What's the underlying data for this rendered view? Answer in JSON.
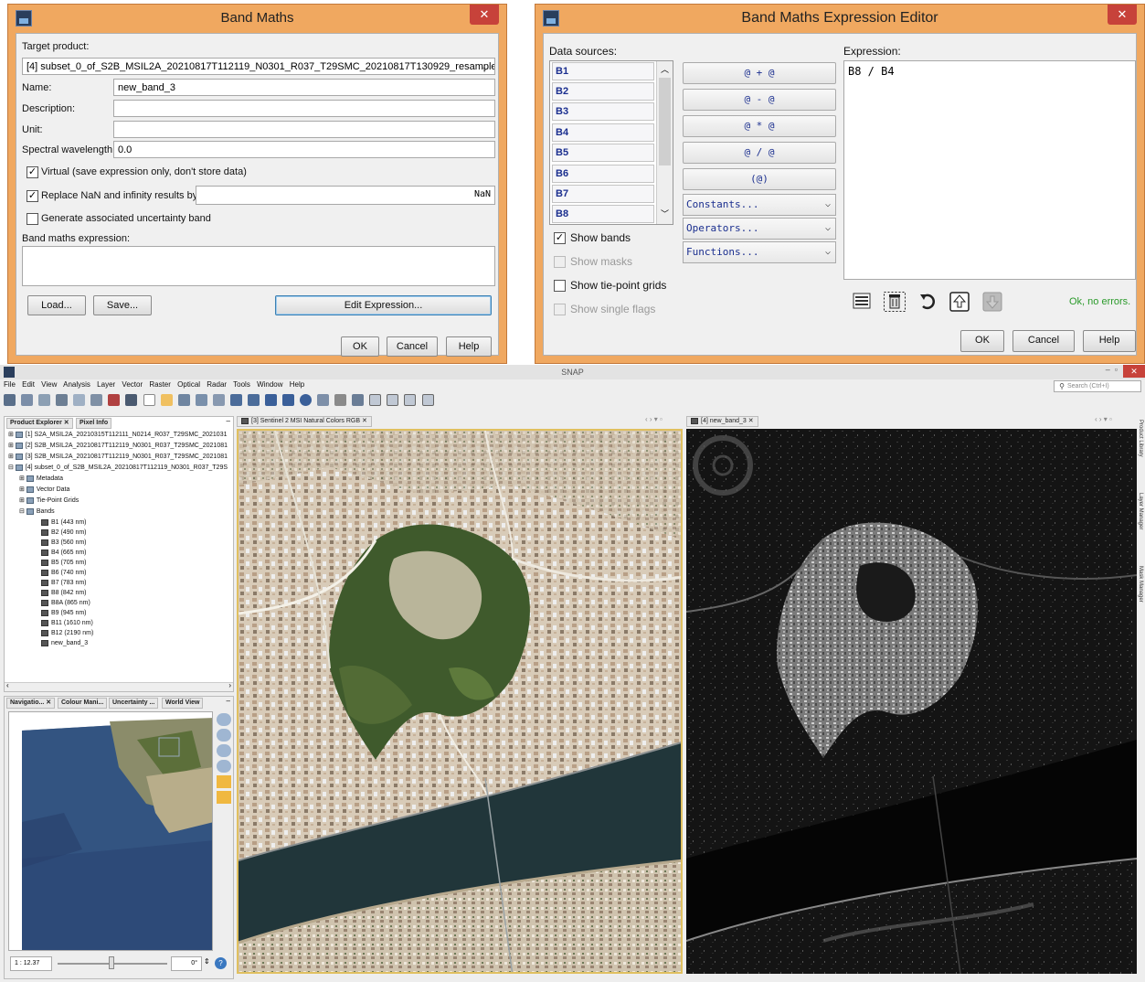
{
  "band_maths": {
    "title": "Band Maths",
    "close": "✕",
    "target_product_label": "Target product:",
    "target_product_value": "[4] subset_0_of_S2B_MSIL2A_20210817T112119_N0301_R037_T29SMC_20210817T130929_resampled",
    "name_label": "Name:",
    "name_value": "new_band_3",
    "description_label": "Description:",
    "description_value": "",
    "unit_label": "Unit:",
    "unit_value": "",
    "spectral_label": "Spectral wavelength:",
    "spectral_value": "0.0",
    "virtual_label": "Virtual (save expression only, don't store data)",
    "virtual_checked": true,
    "replace_nan_label": "Replace NaN and infinity results by",
    "replace_nan_checked": true,
    "replace_nan_value": "NaN",
    "uncertainty_label": "Generate associated uncertainty band",
    "uncertainty_checked": false,
    "expression_label": "Band maths expression:",
    "expression_value": "",
    "load_button": "Load...",
    "save_button": "Save...",
    "edit_button": "Edit Expression...",
    "ok_button": "OK",
    "cancel_button": "Cancel",
    "help_button": "Help"
  },
  "editor": {
    "title": "Band Maths Expression Editor",
    "close": "✕",
    "data_sources_label": "Data sources:",
    "data_sources": [
      "B1",
      "B2",
      "B3",
      "B4",
      "B5",
      "B6",
      "B7",
      "B8"
    ],
    "operator_buttons": [
      "@ + @",
      "@ - @",
      "@ * @",
      "@ / @",
      "(@)"
    ],
    "combos": [
      "Constants...",
      "Operators...",
      "Functions..."
    ],
    "show_bands_label": "Show bands",
    "show_bands_checked": true,
    "show_masks_label": "Show masks",
    "show_tiepoint_label": "Show tie-point grids",
    "show_flags_label": "Show single flags",
    "expression_label": "Expression:",
    "expression_value": "B8 / B4",
    "status": "Ok, no errors.",
    "status_color": "#2a9a2a",
    "ok_button": "OK",
    "cancel_button": "Cancel",
    "help_button": "Help"
  },
  "snap": {
    "title": "SNAP",
    "menu": [
      "File",
      "Edit",
      "View",
      "Analysis",
      "Layer",
      "Vector",
      "Raster",
      "Optical",
      "Radar",
      "Tools",
      "Window",
      "Help"
    ],
    "search_placeholder": "Search (Ctrl+I)",
    "explorer_tabs": [
      "Product Explorer",
      "Pixel Info"
    ],
    "products": [
      "[1] S2A_MSIL2A_20210315T112111_N0214_R037_T29SMC_2021031",
      "[2] S2B_MSIL2A_20210817T112119_N0301_R037_T29SMC_2021081",
      "[3] S2B_MSIL2A_20210817T112119_N0301_R037_T29SMC_2021081",
      "[4] subset_0_of_S2B_MSIL2A_20210817T112119_N0301_R037_T29S"
    ],
    "groups": [
      "Metadata",
      "Vector Data",
      "Tie-Point Grids",
      "Bands"
    ],
    "bands": [
      "B1 (443 nm)",
      "B2 (490 nm)",
      "B3 (560 nm)",
      "B4 (665 nm)",
      "B5 (705 nm)",
      "B6 (740 nm)",
      "B7 (783 nm)",
      "B8 (842 nm)",
      "B8A (865 nm)",
      "B9 (945 nm)",
      "B11 (1610 nm)",
      "B12 (2190 nm)",
      "new_band_3"
    ],
    "nav_tabs": [
      "Navigatio...",
      "Colour Mani...",
      "Uncertainty ...",
      "World View"
    ],
    "scale": "1 : 12.37",
    "rotation": "0°",
    "image_tabs": [
      "[3] Sentinel 2 MSI Natural Colors RGB",
      "[4] new_band_3"
    ],
    "side_tabs": [
      "Product Library",
      "Layer Manager",
      "Mask Manager"
    ]
  }
}
